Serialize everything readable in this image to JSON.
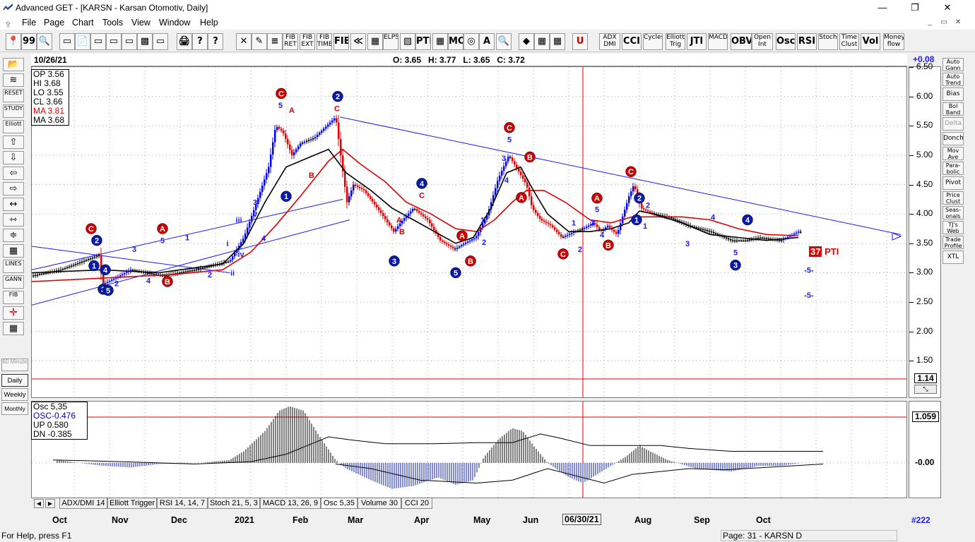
{
  "window": {
    "title": "Advanced GET - [KARSN - Karsan Otomotiv, Daily]",
    "min": "—",
    "max": "❐",
    "close": "✕"
  },
  "menu": [
    "File",
    "Page",
    "Chart",
    "Tools",
    "View",
    "Window",
    "Help"
  ],
  "mdi": [
    "_",
    "▭",
    "✕"
  ],
  "toolbar": {
    "buttons": [
      "📍",
      "99",
      "🔍",
      "▭",
      "📄",
      "▭",
      "▭",
      "▭",
      "▩",
      "▭",
      "🖨",
      "?",
      "?",
      "✕",
      "✎",
      "≡",
      "FIB RET",
      "FIB EXT",
      "FIB TIME",
      "FIB",
      "≪",
      "▦",
      "ELPS",
      "▧",
      "PTI",
      "▦",
      "MOB",
      "◎",
      "A",
      "🔍",
      "◆",
      "▦",
      "▦",
      "U",
      "ADX DMI",
      "CCI",
      "Cycles",
      "Elliott Trig",
      "JTI",
      "MACD",
      "OBV",
      "Open Int",
      "Osc",
      "RSI",
      "Stoch",
      "Time Clust",
      "Vol",
      "Money flow"
    ]
  },
  "left_toolbar": [
    "📂",
    "≋",
    "RESET",
    "STUDY",
    "Elliott",
    "⇧",
    "⇩",
    "⇦",
    "⇨",
    "↔",
    "⇿",
    "≑",
    "▦",
    "LINES",
    "GANN",
    "FIB",
    "✛",
    "▦"
  ],
  "timeframes": [
    "60 Minute",
    "Daily",
    "Weekly",
    "Monthly"
  ],
  "right_toolbar": [
    "Auto Gann",
    "Auto Trend",
    "Bias",
    "Bol Band",
    "Delta",
    "Donch",
    "Mov Ave",
    "Para-bolic",
    "Pivot",
    "Price Clust",
    "Seas-onals",
    "TJ's Web",
    "Trade Profile",
    "XTL"
  ],
  "info": {
    "date": "10/26/21",
    "ohlc": "O: 3.65   H: 3.77   L: 3.65   C: 3.72",
    "change": "+0.08"
  },
  "values_box": [
    {
      "text": "OP 3.56",
      "color": "#000000"
    },
    {
      "text": "HI  3.68",
      "color": "#000000"
    },
    {
      "text": "LO  3.55",
      "color": "#000000"
    },
    {
      "text": "CL  3.66",
      "color": "#000000"
    },
    {
      "text": "MA 3.81",
      "color": "#e00000"
    },
    {
      "text": "MA 3.68",
      "color": "#000000"
    }
  ],
  "osc_box": [
    {
      "text": "Osc 5,35",
      "color": "#000000"
    },
    {
      "text": "OSC-0.476",
      "color": "#0000cc"
    },
    {
      "text": "UP   0.580",
      "color": "#000000"
    },
    {
      "text": "DN   -0.385",
      "color": "#000000"
    }
  ],
  "scale_flags": {
    "price": "1.14",
    "osc": "1.059",
    "osc_zero": "-0.00"
  },
  "pti": {
    "value": "37",
    "label": "PTI"
  },
  "tabs": [
    "ADX/DMI 14",
    "Elliott Trigger",
    "RSI 14, 14, 7",
    "Stoch 21, 5, 3",
    "MACD 13, 26, 9",
    "Osc 5,35",
    "Volume 30",
    "CCI 20"
  ],
  "xaxis_labels": [
    "Oct",
    "Nov",
    "Dec",
    "2021",
    "Feb",
    "Mar",
    "Apr",
    "May",
    "Jun",
    "06/30/21",
    "Aug",
    "Sep",
    "Oct"
  ],
  "page_num": "#222",
  "status": {
    "help": "For Help, press F1",
    "page": "Page: 31 - KARSN D"
  },
  "colors": {
    "up": "#0000ff",
    "down": "#e00000",
    "neutral": "#000000",
    "ma_slow": "#e00000",
    "ma_fast": "#000000",
    "trend": "#1a1aff"
  },
  "chart_data": {
    "type": "bar",
    "y_ticks": [
      "6.50",
      "6.00",
      "5.50",
      "5.00",
      "4.50",
      "4.00",
      "3.50",
      "3.00",
      "2.50",
      "2.00",
      "1.50"
    ],
    "ylim": [
      0.88,
      6.5
    ],
    "price_path": [
      [
        0,
        2.95
      ],
      [
        40,
        3.05
      ],
      [
        95,
        3.3
      ],
      [
        100,
        2.8
      ],
      [
        140,
        3.05
      ],
      [
        185,
        2.95
      ],
      [
        230,
        3.05
      ],
      [
        280,
        3.2
      ],
      [
        300,
        3.6
      ],
      [
        318,
        4.2
      ],
      [
        335,
        4.8
      ],
      [
        345,
        5.5
      ],
      [
        355,
        5.4
      ],
      [
        368,
        5.0
      ],
      [
        380,
        5.2
      ],
      [
        400,
        5.3
      ],
      [
        430,
        5.65
      ],
      [
        438,
        4.9
      ],
      [
        446,
        4.2
      ],
      [
        455,
        4.5
      ],
      [
        470,
        4.4
      ],
      [
        495,
        4.0
      ],
      [
        512,
        3.7
      ],
      [
        525,
        3.9
      ],
      [
        540,
        4.1
      ],
      [
        560,
        3.9
      ],
      [
        578,
        3.55
      ],
      [
        598,
        3.4
      ],
      [
        612,
        3.5
      ],
      [
        628,
        3.6
      ],
      [
        645,
        4.0
      ],
      [
        660,
        4.6
      ],
      [
        675,
        5.0
      ],
      [
        685,
        4.8
      ],
      [
        700,
        4.5
      ],
      [
        708,
        4.1
      ],
      [
        720,
        3.9
      ],
      [
        735,
        3.8
      ],
      [
        750,
        3.6
      ],
      [
        768,
        3.7
      ],
      [
        780,
        3.75
      ],
      [
        795,
        3.85
      ],
      [
        805,
        3.7
      ],
      [
        815,
        3.8
      ],
      [
        828,
        3.65
      ],
      [
        845,
        4.3
      ],
      [
        852,
        4.5
      ],
      [
        862,
        4.1
      ],
      [
        880,
        4.0
      ],
      [
        900,
        3.95
      ],
      [
        930,
        3.8
      ],
      [
        960,
        3.7
      ],
      [
        990,
        3.55
      ],
      [
        1010,
        3.55
      ],
      [
        1030,
        3.6
      ],
      [
        1060,
        3.55
      ],
      [
        1085,
        3.7
      ]
    ],
    "ma_fast_path": [
      [
        0,
        3.0
      ],
      [
        100,
        3.05
      ],
      [
        180,
        3.0
      ],
      [
        270,
        3.15
      ],
      [
        300,
        3.5
      ],
      [
        330,
        4.2
      ],
      [
        360,
        4.8
      ],
      [
        400,
        5.0
      ],
      [
        420,
        5.1
      ],
      [
        445,
        4.7
      ],
      [
        480,
        4.4
      ],
      [
        510,
        4.1
      ],
      [
        540,
        3.9
      ],
      [
        570,
        3.7
      ],
      [
        600,
        3.5
      ],
      [
        625,
        3.6
      ],
      [
        650,
        4.1
      ],
      [
        672,
        4.7
      ],
      [
        692,
        4.8
      ],
      [
        710,
        4.4
      ],
      [
        730,
        4.0
      ],
      [
        760,
        3.7
      ],
      [
        790,
        3.7
      ],
      [
        820,
        3.75
      ],
      [
        845,
        3.85
      ],
      [
        860,
        4.05
      ],
      [
        880,
        4.0
      ],
      [
        920,
        3.85
      ],
      [
        960,
        3.65
      ],
      [
        1000,
        3.6
      ],
      [
        1040,
        3.55
      ],
      [
        1085,
        3.6
      ]
    ],
    "ma_slow_path": [
      [
        0,
        2.85
      ],
      [
        120,
        2.92
      ],
      [
        200,
        2.97
      ],
      [
        270,
        3.05
      ],
      [
        310,
        3.35
      ],
      [
        345,
        3.8
      ],
      [
        380,
        4.3
      ],
      [
        420,
        4.9
      ],
      [
        440,
        5.1
      ],
      [
        465,
        4.85
      ],
      [
        500,
        4.55
      ],
      [
        530,
        4.2
      ],
      [
        565,
        4.0
      ],
      [
        600,
        3.75
      ],
      [
        630,
        3.7
      ],
      [
        655,
        3.9
      ],
      [
        680,
        4.2
      ],
      [
        700,
        4.4
      ],
      [
        725,
        4.4
      ],
      [
        755,
        4.2
      ],
      [
        790,
        3.9
      ],
      [
        820,
        3.85
      ],
      [
        850,
        3.95
      ],
      [
        880,
        3.95
      ],
      [
        920,
        3.95
      ],
      [
        960,
        3.9
      ],
      [
        1000,
        3.75
      ],
      [
        1040,
        3.65
      ],
      [
        1085,
        3.63
      ]
    ],
    "labels": [
      {
        "t": "C",
        "x": 84,
        "p": 3.75,
        "circle": "red"
      },
      {
        "t": "2",
        "x": 92,
        "p": 3.55,
        "circle": "blue"
      },
      {
        "t": "1",
        "x": 88,
        "p": 3.12,
        "circle": "blue"
      },
      {
        "t": "4",
        "x": 104,
        "p": 3.05,
        "circle": "blue"
      },
      {
        "t": "3",
        "x": 101,
        "p": 2.72,
        "circle": "blue"
      },
      {
        "t": "5",
        "x": 108,
        "p": 2.7,
        "circle": "blue"
      },
      {
        "t": "2",
        "x": 120,
        "p": 2.82,
        "color": "blue"
      },
      {
        "t": "A",
        "x": 185,
        "p": 3.75,
        "circle": "red"
      },
      {
        "t": "5",
        "x": 185,
        "p": 3.55,
        "color": "blue"
      },
      {
        "t": "B",
        "x": 192,
        "p": 2.85,
        "circle": "red"
      },
      {
        "t": "3",
        "x": 145,
        "p": 3.4,
        "color": "blue"
      },
      {
        "t": "4",
        "x": 165,
        "p": 2.87,
        "color": "blue"
      },
      {
        "t": "1",
        "x": 220,
        "p": 3.6,
        "color": "blue"
      },
      {
        "t": "2",
        "x": 252,
        "p": 2.97,
        "color": "blue"
      },
      {
        "t": "C",
        "x": 353,
        "p": 6.05,
        "circle": "red"
      },
      {
        "t": "5",
        "x": 352,
        "p": 5.85,
        "color": "blue"
      },
      {
        "t": "A",
        "x": 368,
        "p": 5.77,
        "color": "red"
      },
      {
        "t": "B",
        "x": 396,
        "p": 4.66,
        "color": "red"
      },
      {
        "t": "1",
        "x": 360,
        "p": 4.3,
        "circle": "blue"
      },
      {
        "t": "3",
        "x": 316,
        "p": 4.2,
        "color": "blue"
      },
      {
        "t": "v",
        "x": 316,
        "p": 4.0,
        "color": "blue"
      },
      {
        "t": "iii",
        "x": 293,
        "p": 3.9,
        "color": "blue"
      },
      {
        "t": "4",
        "x": 328,
        "p": 3.59,
        "color": "blue"
      },
      {
        "t": "iv",
        "x": 296,
        "p": 3.32,
        "color": "blue"
      },
      {
        "t": "i",
        "x": 277,
        "p": 3.5,
        "color": "blue"
      },
      {
        "t": "ii",
        "x": 284,
        "p": 3.0,
        "color": "blue"
      },
      {
        "t": "2",
        "x": 433,
        "p": 6.0,
        "circle": "blue"
      },
      {
        "t": "C",
        "x": 432,
        "p": 5.8,
        "color": "red"
      },
      {
        "t": "3",
        "x": 513,
        "p": 3.2,
        "circle": "blue"
      },
      {
        "t": "B",
        "x": 524,
        "p": 3.7,
        "color": "red"
      },
      {
        "t": "A",
        "x": 520,
        "p": 3.9,
        "color": "red"
      },
      {
        "t": "4",
        "x": 552,
        "p": 4.52,
        "circle": "blue"
      },
      {
        "t": "C",
        "x": 552,
        "p": 4.32,
        "color": "red"
      },
      {
        "t": "5",
        "x": 600,
        "p": 3.0,
        "circle": "blue"
      },
      {
        "t": "A",
        "x": 609,
        "p": 3.63,
        "circle": "red"
      },
      {
        "t": "B",
        "x": 621,
        "p": 3.2,
        "circle": "red"
      },
      {
        "t": "2",
        "x": 640,
        "p": 3.52,
        "color": "blue"
      },
      {
        "t": "1",
        "x": 638,
        "p": 3.9,
        "color": "blue"
      },
      {
        "t": "C",
        "x": 676,
        "p": 5.47,
        "circle": "red"
      },
      {
        "t": "5",
        "x": 676,
        "p": 5.27,
        "color": "blue"
      },
      {
        "t": "3",
        "x": 668,
        "p": 4.95,
        "color": "blue"
      },
      {
        "t": "4",
        "x": 672,
        "p": 4.58,
        "color": "blue"
      },
      {
        "t": "B",
        "x": 705,
        "p": 4.97,
        "circle": "red"
      },
      {
        "t": "A",
        "x": 693,
        "p": 4.28,
        "circle": "red"
      },
      {
        "t": "C",
        "x": 752,
        "p": 3.32,
        "circle": "red"
      },
      {
        "t": "1",
        "x": 767,
        "p": 3.85,
        "color": "blue"
      },
      {
        "t": "2",
        "x": 776,
        "p": 3.4,
        "color": "blue"
      },
      {
        "t": "3",
        "x": 794,
        "p": 3.85,
        "color": "blue"
      },
      {
        "t": "A",
        "x": 800,
        "p": 4.27,
        "circle": "red"
      },
      {
        "t": "5",
        "x": 800,
        "p": 4.08,
        "color": "blue"
      },
      {
        "t": "4",
        "x": 807,
        "p": 3.65,
        "color": "blue"
      },
      {
        "t": "B",
        "x": 816,
        "p": 3.47,
        "circle": "red"
      },
      {
        "t": "C",
        "x": 848,
        "p": 4.72,
        "circle": "red"
      },
      {
        "t": "2",
        "x": 860,
        "p": 4.27,
        "circle": "blue"
      },
      {
        "t": "2",
        "x": 872,
        "p": 4.15,
        "color": "blue"
      },
      {
        "t": "1",
        "x": 856,
        "p": 3.9,
        "circle": "blue"
      },
      {
        "t": "1",
        "x": 868,
        "p": 3.8,
        "color": "blue"
      },
      {
        "t": "3",
        "x": 928,
        "p": 3.5,
        "color": "blue"
      },
      {
        "t": "4",
        "x": 964,
        "p": 3.95,
        "color": "blue"
      },
      {
        "t": "4",
        "x": 1013,
        "p": 3.9,
        "circle": "blue"
      },
      {
        "t": "5",
        "x": 996,
        "p": 3.35,
        "color": "blue"
      },
      {
        "t": "3",
        "x": 996,
        "p": 3.13,
        "circle": "blue"
      },
      {
        "t": "-5-",
        "x": 1100,
        "p": 3.05,
        "color": "blue"
      },
      {
        "t": "-5-",
        "x": 1100,
        "p": 2.62,
        "color": "blue"
      }
    ],
    "trend_lines": [
      [
        [
          436,
          5.65
        ],
        [
          1230,
          3.65
        ]
      ],
      [
        [
          0,
          3.05
        ],
        [
          440,
          4.25
        ]
      ],
      [
        [
          0,
          2.45
        ],
        [
          450,
          3.9
        ]
      ],
      [
        [
          0,
          3.45
        ],
        [
          280,
          3.0
        ]
      ]
    ],
    "osc_ylim": [
      -0.6,
      1.06
    ],
    "osc_path": [
      [
        0,
        0.05
      ],
      [
        40,
        0.04
      ],
      [
        100,
        -0.05
      ],
      [
        140,
        -0.08
      ],
      [
        180,
        -0.02
      ],
      [
        240,
        0.0
      ],
      [
        280,
        0.05
      ],
      [
        300,
        0.2
      ],
      [
        330,
        0.55
      ],
      [
        350,
        0.9
      ],
      [
        365,
        0.98
      ],
      [
        385,
        0.9
      ],
      [
        405,
        0.5
      ],
      [
        430,
        0.05
      ],
      [
        445,
        -0.1
      ],
      [
        480,
        -0.3
      ],
      [
        510,
        -0.45
      ],
      [
        540,
        -0.4
      ],
      [
        575,
        -0.25
      ],
      [
        600,
        -0.38
      ],
      [
        625,
        -0.3
      ],
      [
        640,
        0.1
      ],
      [
        660,
        0.4
      ],
      [
        680,
        0.6
      ],
      [
        695,
        0.55
      ],
      [
        710,
        0.3
      ],
      [
        730,
        0.0
      ],
      [
        760,
        -0.25
      ],
      [
        780,
        -0.35
      ],
      [
        800,
        -0.2
      ],
      [
        820,
        -0.05
      ],
      [
        840,
        0.1
      ],
      [
        860,
        0.3
      ],
      [
        875,
        0.2
      ],
      [
        900,
        0.05
      ],
      [
        940,
        -0.1
      ],
      [
        990,
        -0.15
      ],
      [
        1030,
        -0.05
      ],
      [
        1060,
        -0.05
      ],
      [
        1090,
        0.0
      ]
    ],
    "osc_avg_path": [
      [
        0,
        0.05
      ],
      [
        100,
        0.02
      ],
      [
        200,
        -0.02
      ],
      [
        280,
        0.02
      ],
      [
        330,
        0.15
      ],
      [
        360,
        0.3
      ],
      [
        390,
        0.45
      ],
      [
        420,
        0.4
      ],
      [
        470,
        0.33
      ],
      [
        540,
        0.33
      ],
      [
        600,
        0.35
      ],
      [
        650,
        0.35
      ],
      [
        690,
        0.5
      ],
      [
        720,
        0.42
      ],
      [
        760,
        0.3
      ],
      [
        820,
        0.3
      ],
      [
        860,
        0.3
      ],
      [
        900,
        0.25
      ],
      [
        960,
        0.2
      ],
      [
        1090,
        0.2
      ]
    ],
    "osc_lower_path": [
      [
        400,
        -0.02
      ],
      [
        450,
        -0.1
      ],
      [
        520,
        -0.3
      ],
      [
        600,
        -0.35
      ],
      [
        650,
        -0.3
      ],
      [
        700,
        -0.1
      ],
      [
        780,
        -0.35
      ],
      [
        820,
        -0.2
      ],
      [
        900,
        -0.1
      ],
      [
        950,
        -0.12
      ],
      [
        1090,
        -0.02
      ]
    ]
  }
}
